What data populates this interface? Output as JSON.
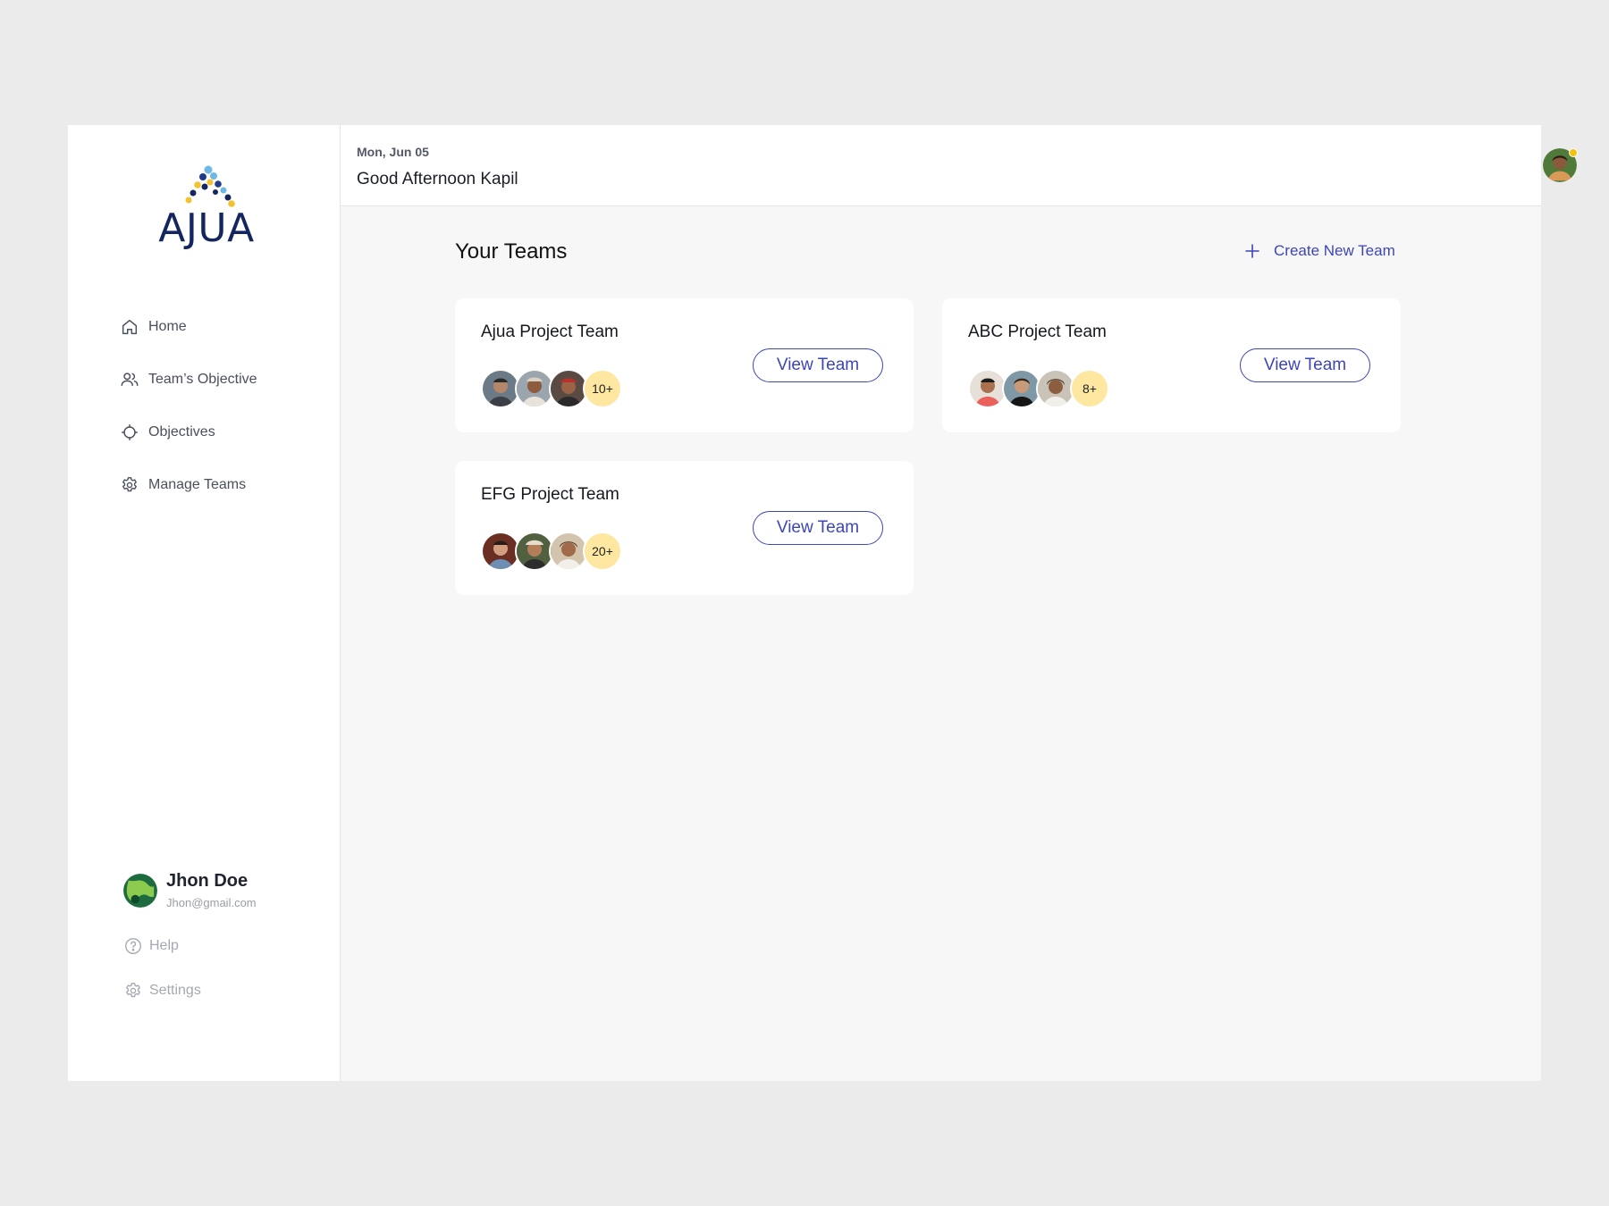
{
  "brand": {
    "name": "AJUA"
  },
  "sidebar": {
    "items": [
      {
        "label": "Home",
        "icon": "home-icon"
      },
      {
        "label": "Team’s Objective",
        "icon": "users-icon"
      },
      {
        "label": "Objectives",
        "icon": "crosshair-icon"
      },
      {
        "label": "Manage Teams",
        "icon": "gear-icon"
      }
    ],
    "profile": {
      "name": "Jhon Doe",
      "email": "Jhon@gmail.com"
    },
    "bottom": [
      {
        "label": "Help",
        "icon": "help-icon"
      },
      {
        "label": "Settings",
        "icon": "gear-icon"
      }
    ]
  },
  "header": {
    "date": "Mon, Jun 05",
    "greeting": "Good Afternoon Kapil"
  },
  "main": {
    "title": "Your Teams",
    "create_label": "Create New Team",
    "teams": [
      {
        "name": "Ajua Project Team",
        "count": "10+",
        "button": "View Team"
      },
      {
        "name": "ABC Project Team",
        "count": "8+",
        "button": "View Team"
      },
      {
        "name": "EFG Project Team",
        "count": "20+",
        "button": "View Team"
      }
    ]
  },
  "colors": {
    "accent": "#3d46b5",
    "brand_navy": "#15265f",
    "badge": "#fde7a1",
    "status_dot": "#f4c20d"
  }
}
